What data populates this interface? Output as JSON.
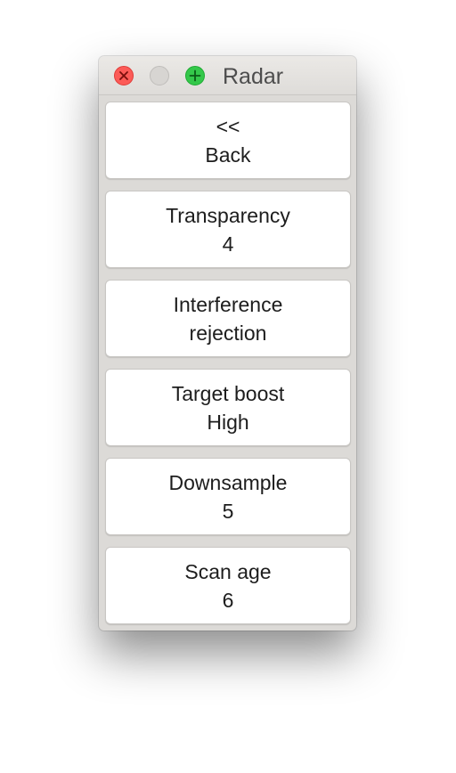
{
  "window": {
    "title": "Radar"
  },
  "menu": {
    "items": [
      {
        "line1": "<<",
        "line2": "Back"
      },
      {
        "line1": "Transparency",
        "line2": "4"
      },
      {
        "line1": "Interference",
        "line2": "rejection"
      },
      {
        "line1": "Target boost",
        "line2": "High"
      },
      {
        "line1": "Downsample",
        "line2": "5"
      },
      {
        "line1": "Scan age",
        "line2": "6"
      }
    ]
  },
  "colors": {
    "close": "#fc5b57",
    "zoom": "#34c84a",
    "window_bg": "#dcdad7"
  },
  "icons": {
    "close": "close-x-icon",
    "minimize": "minimize-disabled-icon",
    "zoom": "zoom-plus-icon"
  }
}
